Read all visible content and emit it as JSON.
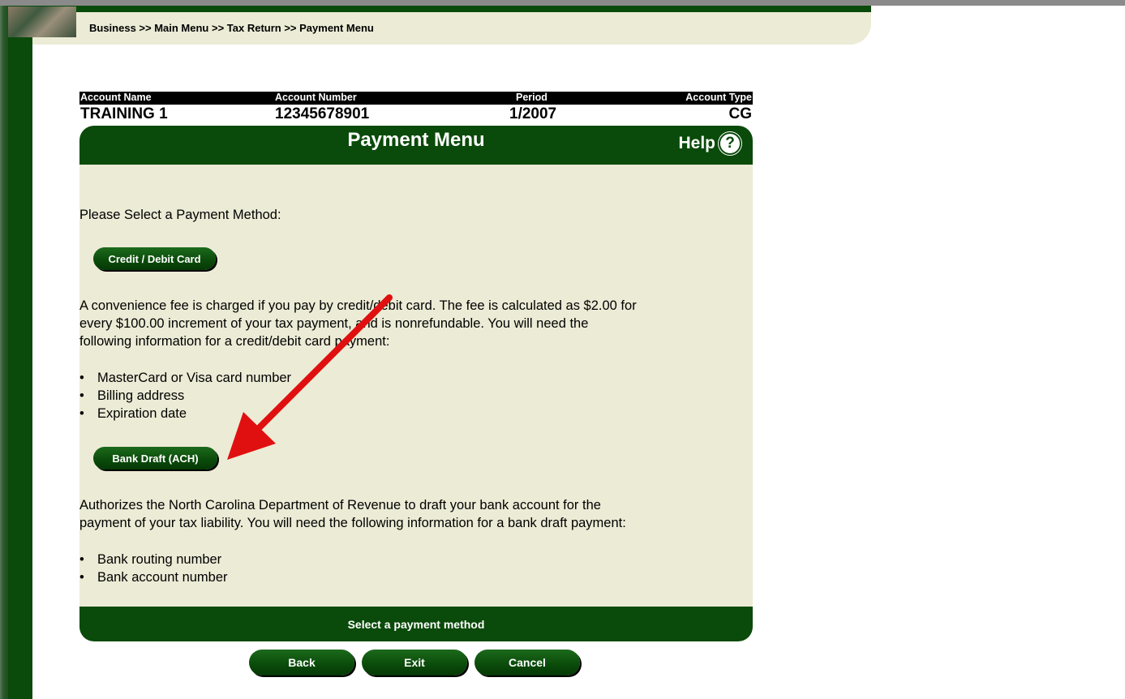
{
  "breadcrumb": "Business >> Main Menu >> Tax Return >> Payment Menu",
  "account": {
    "labels": {
      "name": "Account Name",
      "number": "Account Number",
      "period": "Period",
      "type": "Account Type"
    },
    "values": {
      "name": "TRAINING 1",
      "number": "12345678901",
      "period": "1/2007",
      "type": "CG"
    }
  },
  "title": "Payment Menu",
  "help_label": "Help",
  "help_icon_glyph": "?",
  "content": {
    "prompt": "Please Select a Payment Method:",
    "card_button": "Credit / Debit Card",
    "card_desc_lines": [
      "A convenience fee is charged if you pay by credit/debit card. The fee is calculated as $2.00 for",
      "every $100.00 increment of your tax payment, and is nonrefundable. You will need the",
      "following information for a credit/debit card payment:"
    ],
    "card_requirements": [
      "MasterCard or Visa card number",
      "Billing address",
      "Expiration date"
    ],
    "ach_button": "Bank Draft (ACH)",
    "ach_desc_lines": [
      "Authorizes the North Carolina Department of Revenue to draft your bank account for the",
      "payment of your tax liability. You will need the following information for a bank draft payment:"
    ],
    "ach_requirements": [
      "Bank routing number",
      "Bank account number"
    ]
  },
  "status_message": "Select a payment method",
  "buttons": {
    "back": "Back",
    "exit": "Exit",
    "cancel": "Cancel"
  },
  "colors": {
    "brand_green": "#0a4a0a",
    "panel_beige": "#ecebd6",
    "annotation_red": "#e01010"
  },
  "annotation": "red-arrow-pointing-to-bank-draft-button"
}
